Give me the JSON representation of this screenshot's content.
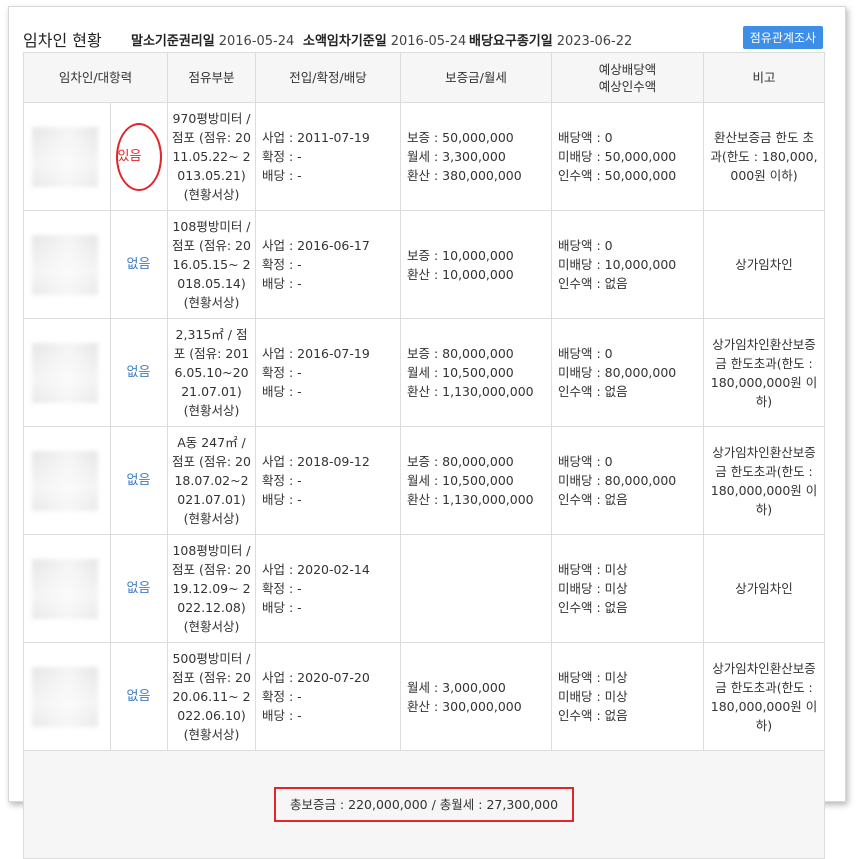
{
  "header": {
    "title": "임차인 현황",
    "items": [
      {
        "label": "말소기준권리일",
        "value": "2016-05-24"
      },
      {
        "label": "소액임차기준일",
        "value": "2016-05-24"
      },
      {
        "label": "배당요구종기일",
        "value": "2023-06-22"
      }
    ],
    "button_label": "점유관계조사"
  },
  "table": {
    "columns": [
      "임차인/대항력",
      "점유부분",
      "전입/확정/배당",
      "보증금/월세",
      "예상배당액",
      "예상인수액",
      "비고"
    ],
    "rows": [
      {
        "status": "있음",
        "occupancy": "970평방미터 / 점포 (점유: 2011.05.22~ 2013.05.21) (현황서상)",
        "dates": [
          "사업 : 2011-07-19",
          "확정 : -",
          "배당 : -"
        ],
        "money": [
          "보증 : 50,000,000",
          "월세 : 3,300,000",
          "환산 : 380,000,000"
        ],
        "dividend": [
          "배당액 : 0",
          "미배당 : 50,000,000",
          "인수액 : 50,000,000"
        ],
        "remark": "환산보증금 한도 초과(한도 : 180,000,000원 이하)"
      },
      {
        "status": "없음",
        "occupancy": "108평방미터 / 점포 (점유: 2016.05.15~ 2018.05.14) (현황서상)",
        "dates": [
          "사업 : 2016-06-17",
          "확정 : -",
          "배당 : -"
        ],
        "money": [
          "보증 : 10,000,000",
          "환산 : 10,000,000"
        ],
        "dividend": [
          "배당액 : 0",
          "미배당 : 10,000,000",
          "인수액 : 없음"
        ],
        "remark": "상가임차인"
      },
      {
        "status": "없음",
        "occupancy": "2,315㎡ / 점포 (점유: 2016.05.10~2021.07.01) (현황서상)",
        "dates": [
          "사업 : 2016-07-19",
          "확정 : -",
          "배당 : -"
        ],
        "money": [
          "보증 : 80,000,000",
          "월세 : 10,500,000",
          "환산 : 1,130,000,000"
        ],
        "dividend": [
          "배당액 : 0",
          "미배당 : 80,000,000",
          "인수액 : 없음"
        ],
        "remark": "상가임차인환산보증금 한도초과(한도 : 180,000,000원 이하)"
      },
      {
        "status": "없음",
        "occupancy": "A동 247㎡ / 점포 (점유: 2018.07.02~2021.07.01) (현황서상)",
        "dates": [
          "사업 : 2018-09-12",
          "확정 : -",
          "배당 : -"
        ],
        "money": [
          "보증 : 80,000,000",
          "월세 : 10,500,000",
          "환산 : 1,130,000,000"
        ],
        "dividend": [
          "배당액 : 0",
          "미배당 : 80,000,000",
          "인수액 : 없음"
        ],
        "remark": "상가임차인환산보증금 한도초과(한도 : 180,000,000원 이하)"
      },
      {
        "status": "없음",
        "occupancy": "108평방미터 / 점포 (점유: 2019.12.09~ 2022.12.08) (현황서상)",
        "dates": [
          "사업 : 2020-02-14",
          "확정 : -",
          "배당 : -"
        ],
        "money": [],
        "dividend": [
          "배당액 : 미상",
          "미배당 : 미상",
          "인수액 : 없음"
        ],
        "remark": "상가임차인"
      },
      {
        "status": "없음",
        "occupancy": "500평방미터 / 점포 (점유: 2020.06.11~ 2022.06.10) (현황서상)",
        "dates": [
          "사업 : 2020-07-20",
          "확정 : -",
          "배당 : -"
        ],
        "money": [
          "월세 : 3,000,000",
          "환산 : 300,000,000"
        ],
        "dividend": [
          "배당액 : 미상",
          "미배당 : 미상",
          "인수액 : 없음"
        ],
        "remark": "상가임차인환산보증금 한도초과(한도 : 180,000,000원 이하)"
      }
    ],
    "summary": "총보증금 : 220,000,000  /  총월세 : 27,300,000"
  },
  "colors": {
    "accent": "#3d8ee6",
    "highlight_red": "#e0262b",
    "status_no": "#3b7fc4",
    "header_bg": "#f6f6f6"
  }
}
